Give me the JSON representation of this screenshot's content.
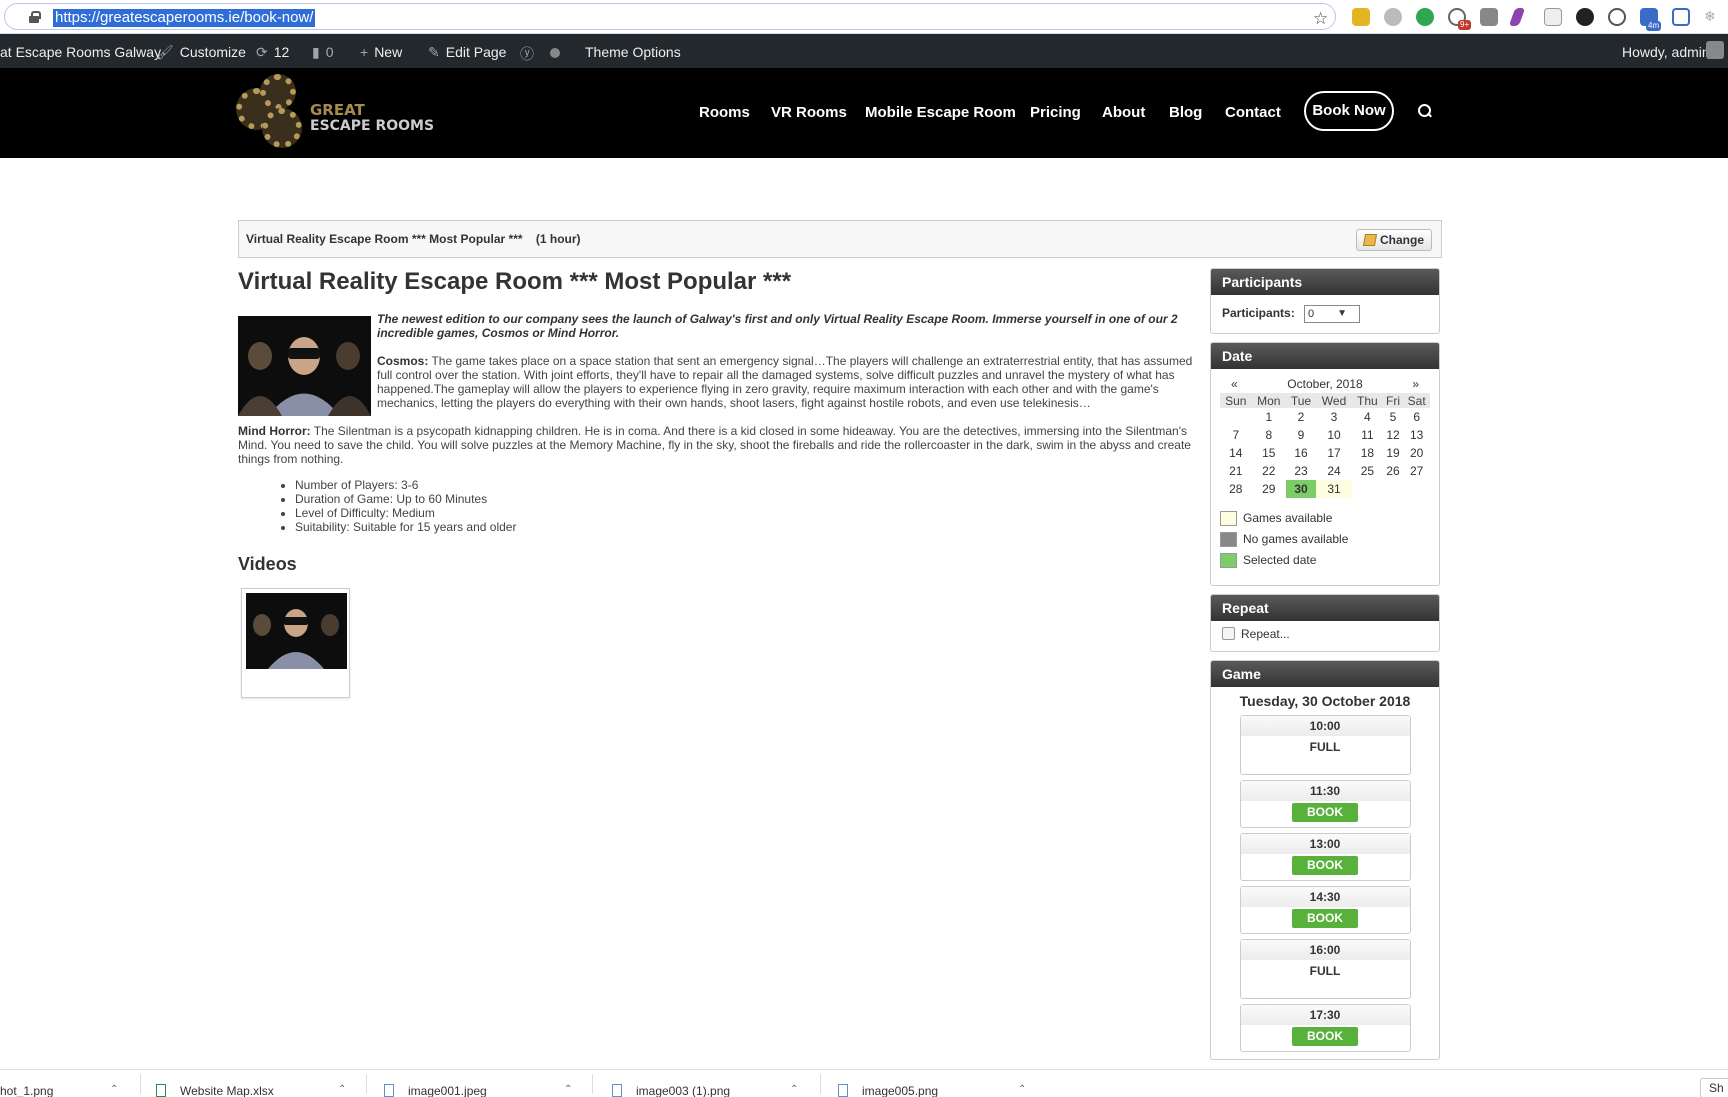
{
  "browser": {
    "url": "https://greatescaperooms.ie/book-now/",
    "star_icon": "star-icon",
    "extension_badges": [
      "9+",
      "4m"
    ]
  },
  "admin_bar": {
    "site_name": "at Escape Rooms Galway",
    "customize": "Customize",
    "updates_count": "12",
    "comments_count": "0",
    "new": "New",
    "edit_page": "Edit Page",
    "theme_options": "Theme Options",
    "howdy": "Howdy, admin"
  },
  "header": {
    "logo_line1": "GREAT",
    "logo_line2": "ESCAPE ROOMS",
    "nav": [
      "Rooms",
      "VR Rooms",
      "Mobile Escape Room",
      "Pricing",
      "About",
      "Blog",
      "Contact"
    ],
    "book_now": "Book Now"
  },
  "summary": {
    "title": "Virtual Reality Escape Room *** Most Popular ***",
    "duration": "(1 hour)",
    "change": "Change"
  },
  "room": {
    "title": "Virtual Reality Escape Room *** Most Popular ***",
    "intro": "The newest edition to our company sees the launch of Galway's first and only Virtual Reality Escape Room. Immerse yourself in one of our 2 incredible games, Cosmos or Mind Horror.",
    "cosmos_label": "Cosmos:",
    "cosmos_text": " The game takes place on a space station that sent an emergency signal…The players will challenge an extraterrestrial entity, that has assumed full control over the station. With joint efforts, they'll have to repair all the damaged systems, solve difficult puzzles and unravel the mystery of what has happened.The gameplay will allow the players to experience flying in zero gravity, require maximum interaction with each other and with the game's mechanics, letting the players do everything with their own hands, shoot lasers, fight against hostile robots, and even use telekinesis…",
    "mind_label": "Mind Horror:",
    "mind_text": " The Silentman is a psycopath kidnapping children. He is in coma. And there is a kid closed in some hideaway. You are the detectives, immersing into the Silentman's Mind. You need to save the child. You will solve puzzles at the Memory Machine, fly in the sky, shoot the fireballs and ride the rollercoaster in the dark, swim in the abyss and create things from nothing.",
    "facts": [
      "Number of Players: 3-6",
      "Duration of Game: Up to 60 Minutes",
      "Level of Difficulty: Medium",
      "Suitability: Suitable for 15 years and older"
    ],
    "videos_heading": "Videos"
  },
  "participants": {
    "heading": "Participants",
    "label": "Participants:",
    "value": "0"
  },
  "date": {
    "heading": "Date",
    "prev": "«",
    "next": "»",
    "month": "October, 2018",
    "weekdays": [
      "Sun",
      "Mon",
      "Tue",
      "Wed",
      "Thu",
      "Fri",
      "Sat"
    ],
    "weeks": [
      [
        "",
        "1",
        "2",
        "3",
        "4",
        "5",
        "6"
      ],
      [
        "7",
        "8",
        "9",
        "10",
        "11",
        "12",
        "13"
      ],
      [
        "14",
        "15",
        "16",
        "17",
        "18",
        "19",
        "20"
      ],
      [
        "21",
        "22",
        "23",
        "24",
        "25",
        "26",
        "27"
      ],
      [
        "28",
        "29",
        "30",
        "31",
        "",
        "",
        ""
      ]
    ],
    "selected_day": "30",
    "available_days": [
      "31"
    ],
    "legend": {
      "available": "Games available",
      "unavailable": "No games available",
      "selected": "Selected date"
    },
    "colors": {
      "available": "#fdfde0",
      "unavailable": "#888888",
      "selected": "#7ccd6a"
    }
  },
  "repeat": {
    "heading": "Repeat",
    "label": "Repeat..."
  },
  "game": {
    "heading": "Game",
    "date": "Tuesday, 30 October 2018",
    "slots": [
      {
        "time": "10:00",
        "status": "FULL"
      },
      {
        "time": "11:30",
        "status": "BOOK"
      },
      {
        "time": "13:00",
        "status": "BOOK"
      },
      {
        "time": "14:30",
        "status": "BOOK"
      },
      {
        "time": "16:00",
        "status": "FULL"
      },
      {
        "time": "17:30",
        "status": "BOOK"
      }
    ]
  },
  "downloads": [
    "hot_1.png",
    "Website Map.xlsx",
    "image001.jpeg",
    "image003 (1).png",
    "image005.png"
  ],
  "downloads_show_all": "Sh"
}
